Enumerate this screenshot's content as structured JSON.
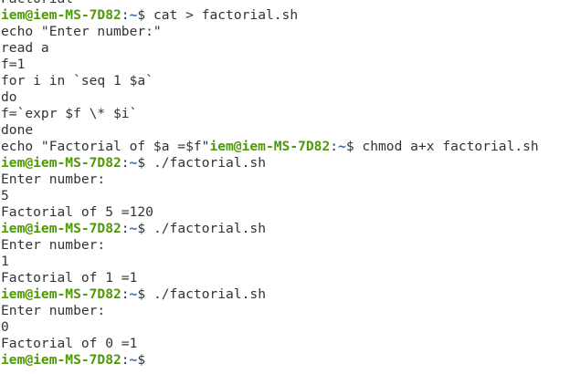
{
  "terminal": {
    "colors": {
      "background": "#ffffff",
      "text": "#2e3436",
      "prompt_user": "#4e9a06",
      "prompt_path": "#3465a4"
    },
    "prompt": {
      "user_host": "iem@iem-MS-7D82",
      "separator": ":",
      "path": "~",
      "symbol": "$"
    },
    "lines": [
      {
        "type": "output",
        "text": "Factorial"
      },
      {
        "type": "prompt",
        "command": " cat > factorial.sh"
      },
      {
        "type": "output",
        "text": "echo \"Enter number:\""
      },
      {
        "type": "output",
        "text": "read a"
      },
      {
        "type": "output",
        "text": "f=1"
      },
      {
        "type": "output",
        "text": "for i in `seq 1 $a`"
      },
      {
        "type": "output",
        "text": "do"
      },
      {
        "type": "output",
        "text": "f=`expr $f \\* $i`"
      },
      {
        "type": "output",
        "text": "done"
      },
      {
        "type": "mixed",
        "before": "echo \"Factorial of $a =$f\"",
        "command": " chmod a+x factorial.sh"
      },
      {
        "type": "prompt",
        "command": " ./factorial.sh"
      },
      {
        "type": "output",
        "text": "Enter number:"
      },
      {
        "type": "output",
        "text": "5"
      },
      {
        "type": "output",
        "text": "Factorial of 5 =120"
      },
      {
        "type": "prompt",
        "command": " ./factorial.sh"
      },
      {
        "type": "output",
        "text": "Enter number:"
      },
      {
        "type": "output",
        "text": "1"
      },
      {
        "type": "output",
        "text": "Factorial of 1 =1"
      },
      {
        "type": "prompt",
        "command": " ./factorial.sh"
      },
      {
        "type": "output",
        "text": "Enter number:"
      },
      {
        "type": "output",
        "text": "0"
      },
      {
        "type": "output",
        "text": "Factorial of 0 =1"
      },
      {
        "type": "prompt",
        "command": ""
      }
    ]
  }
}
